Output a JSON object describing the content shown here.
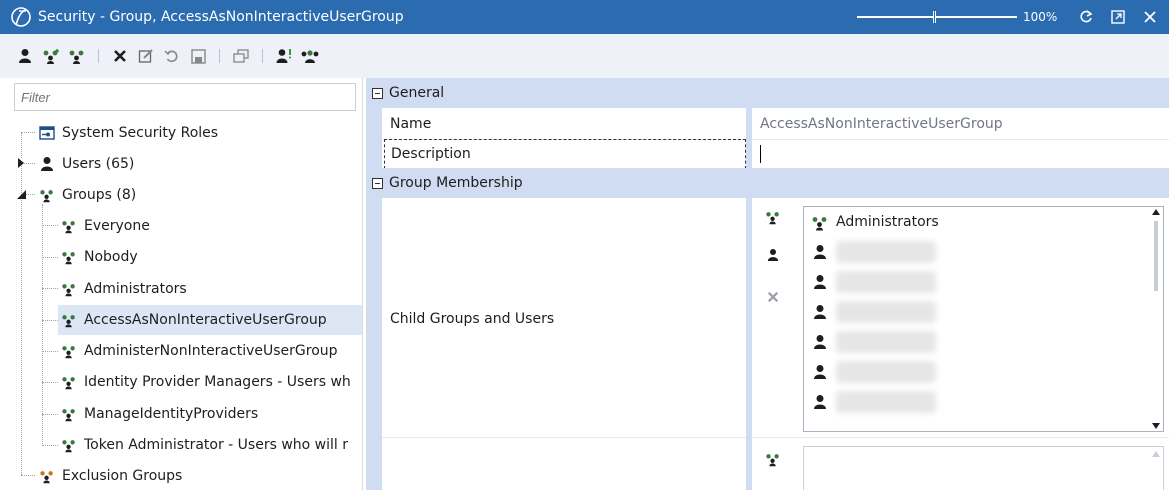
{
  "window": {
    "title": "Security - Group, AccessAsNonInteractiveUserGroup",
    "zoom": "100%",
    "accent": "#2b6cb0"
  },
  "toolbar": {
    "buttons": [
      "user-icon",
      "add-group-icon",
      "group-icon",
      "delete-icon",
      "edit-icon",
      "undo-icon",
      "save-icon",
      "window-icon",
      "user-alert-icon",
      "group-users-icon"
    ]
  },
  "left": {
    "filter_placeholder": "Filter",
    "tree": {
      "system_roles": "System Security Roles",
      "users": "Users (65)",
      "groups": "Groups (8)",
      "group_items": [
        "Everyone",
        "Nobody",
        "Administrators",
        "AccessAsNonInteractiveUserGroup",
        "AdministerNonInteractiveUserGroup",
        "Identity Provider Managers - Users wh",
        "ManageIdentityProviders",
        "Token Administrator - Users who will r"
      ],
      "selected": "AccessAsNonInteractiveUserGroup",
      "exclusion_groups": "Exclusion Groups"
    }
  },
  "grid": {
    "general": "General",
    "name_label": "Name",
    "name_value": "AccessAsNonInteractiveUserGroup",
    "description_label": "Description",
    "description_value": "",
    "membership": "Group Membership",
    "child_label": "Child Groups and Users",
    "child_list": {
      "first": "Administrators"
    }
  }
}
